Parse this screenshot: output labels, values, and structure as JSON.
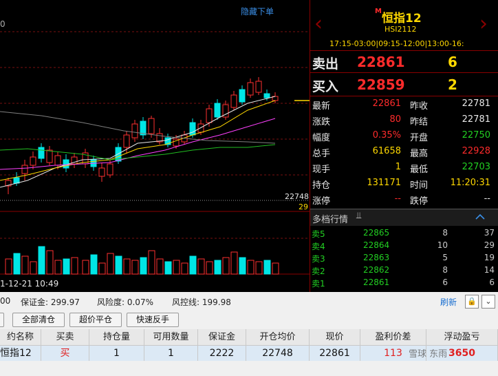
{
  "chart": {
    "hide_order_label": "隐藏下单",
    "top_axis_label": "0",
    "price_level": "22748",
    "volume_level": "29",
    "date_label": "1-12-21 10:49"
  },
  "quote": {
    "marker": "M",
    "name": "恒指12",
    "code": "HSI2112",
    "session": "17:15-03:00|09:15-12:00|13:00-16:",
    "sell_label": "卖出",
    "sell_price": "22861",
    "sell_qty": "6",
    "buy_label": "买入",
    "buy_price": "22859",
    "buy_qty": "2",
    "stats": [
      {
        "label": "最新",
        "value": "22861",
        "label2": "昨收",
        "value2": "22781"
      },
      {
        "label": "涨跌",
        "value": "80",
        "label2": "昨结",
        "value2": "22781"
      },
      {
        "label": "幅度",
        "value": "0.35%",
        "label2": "开盘",
        "value2": "22750"
      },
      {
        "label": "总手",
        "value": "61658",
        "label2": "最高",
        "value2": "22928"
      },
      {
        "label": "现手",
        "value": "1",
        "label2": "最低",
        "value2": "22703"
      },
      {
        "label": "持仓",
        "value": "131171",
        "label2": "时间",
        "value2": "11:20:31"
      },
      {
        "label": "涨停",
        "value": "--",
        "label2": "跌停",
        "value2": "--"
      }
    ],
    "depth_title": "多档行情",
    "depth": [
      {
        "label": "卖5",
        "price": "22865",
        "qty": "8",
        "extra": "37"
      },
      {
        "label": "卖4",
        "price": "22864",
        "qty": "10",
        "extra": "29"
      },
      {
        "label": "卖3",
        "price": "22863",
        "qty": "5",
        "extra": "19"
      },
      {
        "label": "卖2",
        "price": "22862",
        "qty": "8",
        "extra": "14"
      },
      {
        "label": "卖1",
        "price": "22861",
        "qty": "6",
        "extra": "6"
      }
    ]
  },
  "account": {
    "first_value": "00",
    "margin": "保证金: 299.97",
    "risk": "风险度: 0.07%",
    "risk_line": "风控线: 199.98",
    "refresh": "刷新"
  },
  "buttons": {
    "close_all": "全部清仓",
    "close_limit": "超价平仓",
    "reverse": "快速反手"
  },
  "positions": {
    "headers": [
      "约名称",
      "买卖",
      "持仓量",
      "可用数量",
      "保证金",
      "开仓均价",
      "现价",
      "盈利价差",
      "浮动盈亏"
    ],
    "row": [
      "恒指12",
      "买",
      "1",
      "1",
      "2222",
      "22748",
      "22861",
      "113",
      "3650"
    ]
  },
  "watermark": "雪球 东雨"
}
